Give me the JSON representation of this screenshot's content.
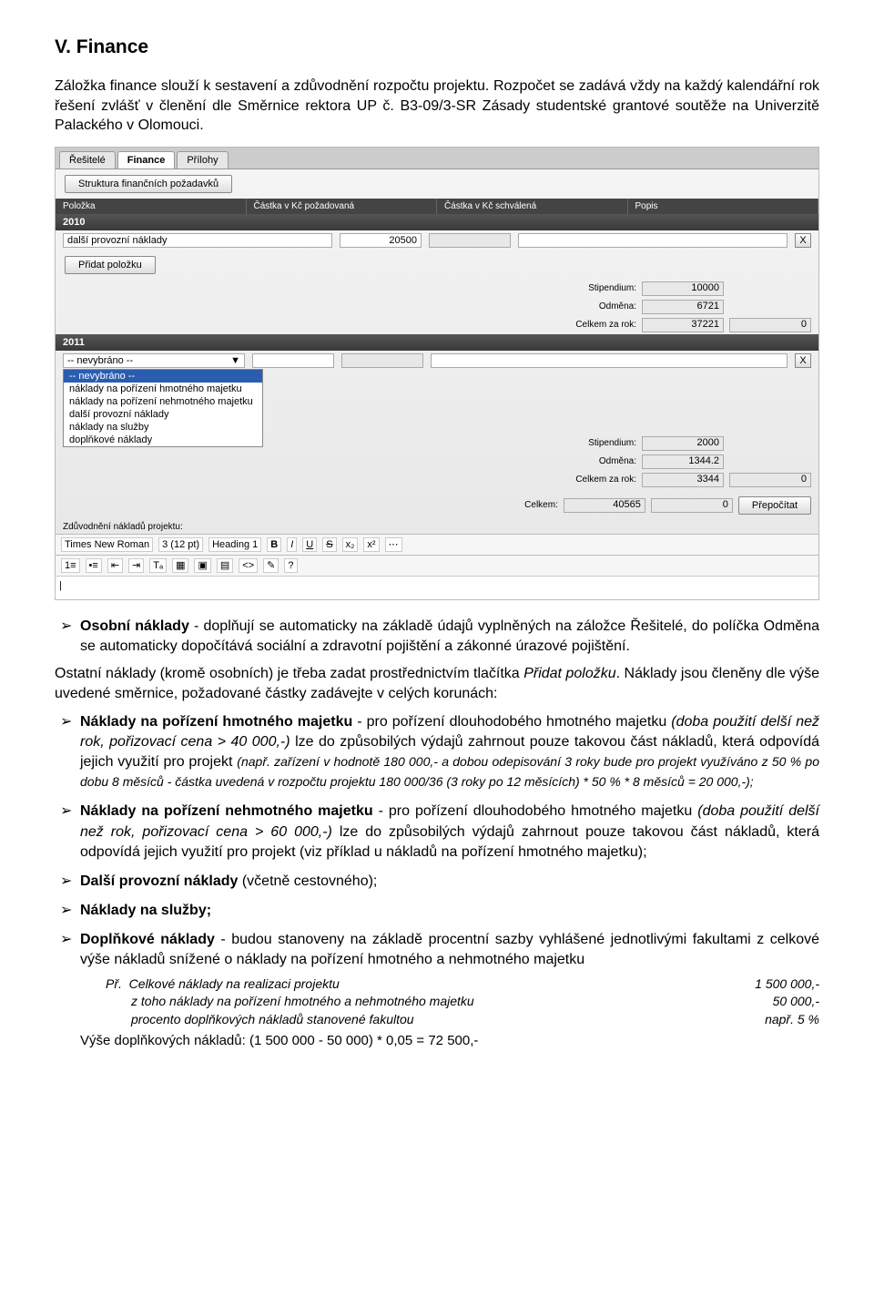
{
  "heading": "V. Finance",
  "intro": "Záložka finance slouží k sestavení a zdůvodnění rozpočtu projektu. Rozpočet se zadává vždy na každý kalendářní rok řešení zvlášť v členění dle Směrnice rektora UP č. B3-09/3-SR Zásady studentské grantové soutěže na Univerzitě Palackého v Olomouci.",
  "screenshot": {
    "tabs": {
      "t1": "Řešitelé",
      "t2": "Finance",
      "t3": "Přílohy"
    },
    "btn_structure": "Struktura finančních požadavků",
    "columns": {
      "c1": "Položka",
      "c2": "Částka v Kč požadovaná",
      "c3": "Částka v Kč schválená",
      "c4": "Popis"
    },
    "year2010": "2010",
    "row1_label": "další provozní náklady",
    "row1_amount": "20500",
    "btn_add": "Přidat položku",
    "lab_stipendium": "Stipendium:",
    "lab_odmena": "Odměna:",
    "lab_celkem_rok": "Celkem za rok:",
    "stip2010": "10000",
    "odm2010": "6721",
    "celk2010": "37221",
    "zero": "0",
    "year2011": "2011",
    "dd_selected": "-- nevybráno --",
    "dd_opts": {
      "o0": "-- nevybráno --",
      "o1": "náklady na pořízení hmotného majetku",
      "o2": "náklady na pořízení nehmotného majetku",
      "o3": "další provozní náklady",
      "o4": "náklady na služby",
      "o5": "doplňkové náklady"
    },
    "stip2011": "2000",
    "odm2011": "1344.2",
    "celk2011": "3344",
    "lab_celkem": "Celkem:",
    "celkem": "40565",
    "btn_recalc": "Přepočítat",
    "justify_label": "Zdůvodnění nákladů projektu:",
    "font": "Times New Roman",
    "size": "3 (12 pt)",
    "style": "Heading 1",
    "btn_x": "X",
    "chev": "▼"
  },
  "para_personal": "Osobní náklady - doplňují se automaticky na základě údajů vyplněných na záložce Řešitelé, do políčka Odměna se automaticky dopočítává sociální a zdravotní pojištění a zákonné úrazové pojištění.",
  "para_other": "Ostatní náklady (kromě osobních) je třeba zadat prostřednictvím tlačítka Přidat položku. Náklady jsou členěny dle výše uvedené směrnice, požadované částky zadávejte v celých korunách:",
  "b1a": "Náklady na pořízení hmotného majetku",
  "b1b": " - pro pořízení dlouhodobého hmotného majetku ",
  "b1c": "(doba použití delší než rok, pořizovací cena > 40 000,-)",
  "b1d": " lze do způsobilých výdajů zahrnout pouze takovou část nákladů, která odpovídá jejich využití pro projekt ",
  "b1e": "(např. zařízení v hodnotě 180 000,- a dobou odepisování 3 roky bude pro projekt využíváno z 50 % po dobu 8 měsíců - částka uvedená v rozpočtu projektu 180 000/36 (3 roky po 12 měsících) * 50 % * 8 měsíců = 20 000,-);",
  "b2a": "Náklady na pořízení nehmotného majetku",
  "b2b": " - pro pořízení dlouhodobého hmotného majetku ",
  "b2c": "(doba použití delší než rok, pořizovací cena > 60 000,-)",
  "b2d": " lze do způsobilých výdajů zahrnout pouze takovou část nákladů, která odpovídá jejich využití pro projekt (viz příklad u nákladů na pořízení hmotného majetku);",
  "b3a": "Další provozní náklady",
  "b3b": " (včetně cestovného);",
  "b4a": "Náklady na služby;",
  "b5a": "Doplňkové náklady",
  "b5b": " - budou stanoveny na základě procentní sazby vyhlášené jednotlivými fakultami z celkové výše nákladů snížené o náklady na pořízení hmotného a nehmotného majetku",
  "ex_pr": "Př.",
  "ex_l1": "Celkové náklady na realizaci projektu",
  "ex_v1": "1 500 000,-",
  "ex_l2": "z toho náklady na pořízení hmotného a nehmotného majetku",
  "ex_v2": "50 000,-",
  "ex_l3": "procento doplňkových nákladů stanovené fakultou",
  "ex_v3": "např. 5 %",
  "ex_total": "Výše doplňkových nákladů: (1 500 000 - 50 000) * 0,05 = 72 500,-"
}
